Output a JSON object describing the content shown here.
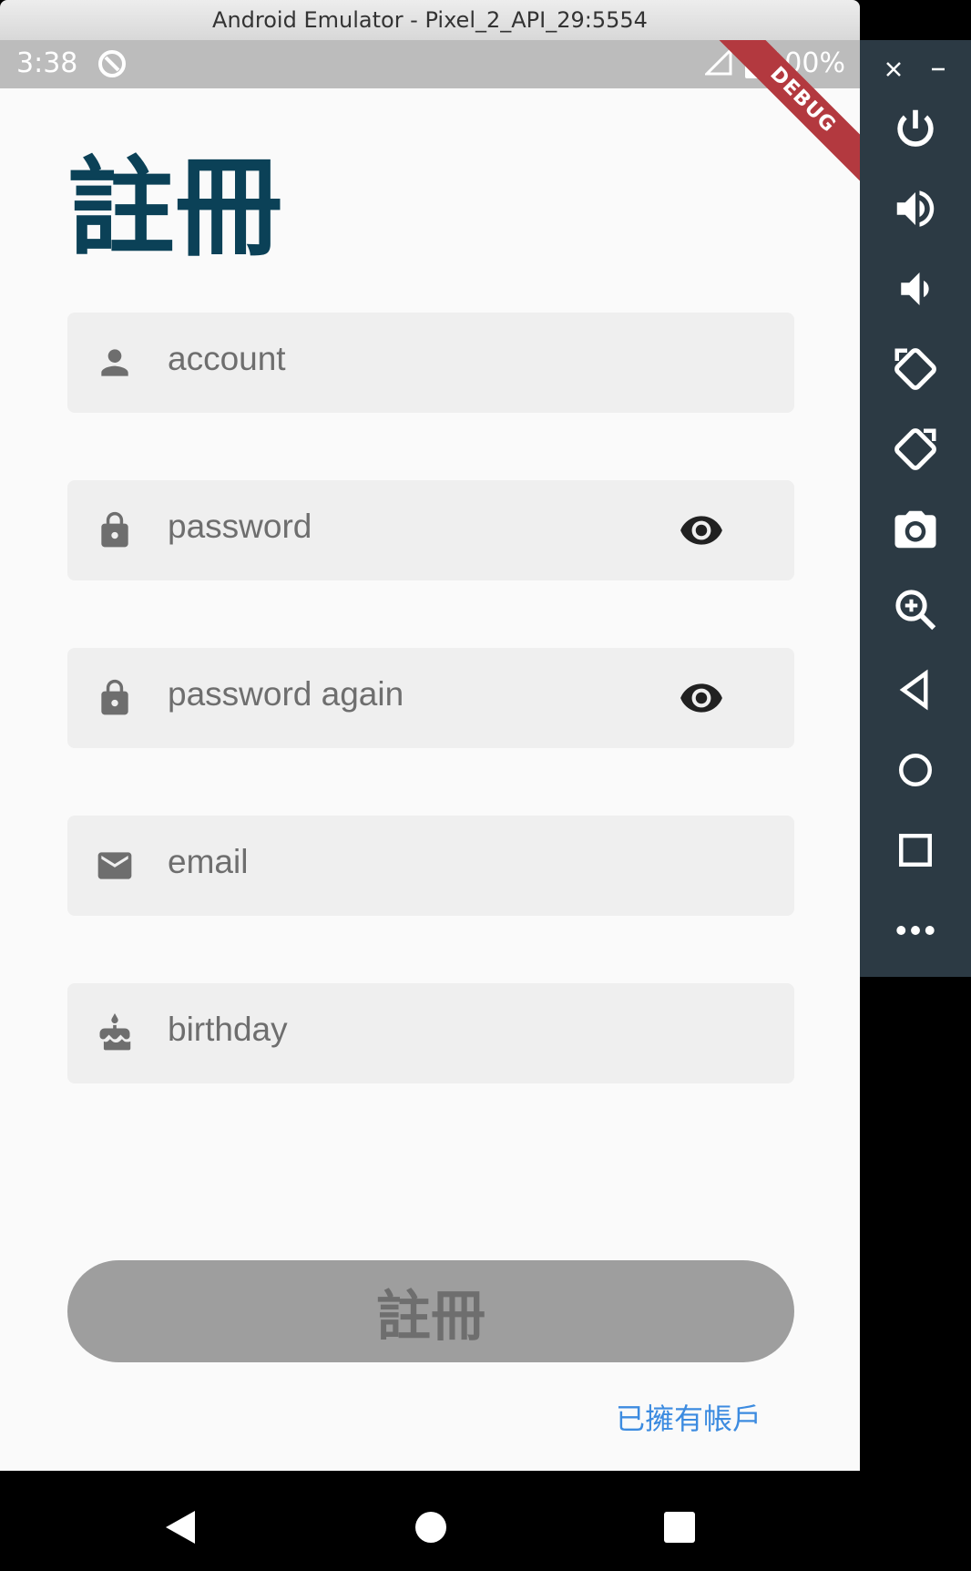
{
  "window": {
    "title": "Android Emulator - Pixel_2_API_29:5554"
  },
  "status_bar": {
    "time": "3:38",
    "battery": "100%",
    "debug_banner": "DEBUG"
  },
  "page": {
    "title": "註冊"
  },
  "form": {
    "account": {
      "placeholder": "account",
      "icon": "person-icon"
    },
    "password": {
      "placeholder": "password",
      "icon": "lock-icon",
      "toggle_icon": "eye-icon"
    },
    "password_again": {
      "placeholder": "password again",
      "icon": "lock-icon",
      "toggle_icon": "eye-icon"
    },
    "email": {
      "placeholder": "email",
      "icon": "mail-icon"
    },
    "birthday": {
      "placeholder": "birthday",
      "icon": "cake-icon"
    }
  },
  "buttons": {
    "register": "註冊",
    "have_account": "已擁有帳戶"
  },
  "emulator_toolbar": {
    "items": [
      "close-icon",
      "minimize-icon",
      "power-icon",
      "volume-up-icon",
      "volume-down-icon",
      "rotate-left-icon",
      "rotate-right-icon",
      "camera-icon",
      "zoom-icon",
      "back-icon",
      "home-icon",
      "overview-icon",
      "more-icon"
    ]
  },
  "colors": {
    "title": "#0b4157",
    "link": "#3c8be0",
    "button_disabled": "#9e9e9e",
    "debug": "#b3393f"
  }
}
